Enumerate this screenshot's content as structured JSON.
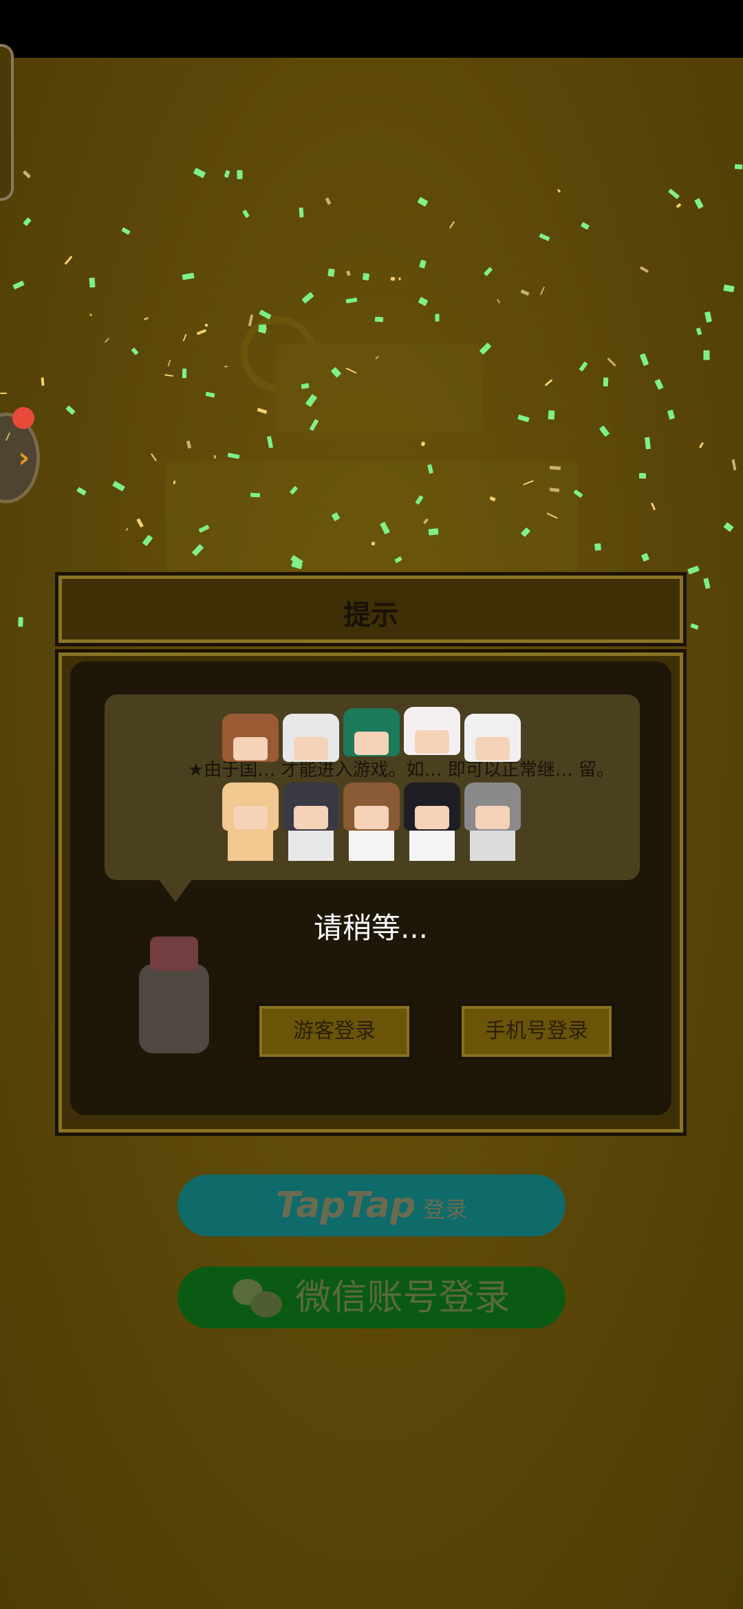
{
  "dialog": {
    "title": "提示",
    "notice_text": "★由于国… 才能进入游戏。如… 即可以正常继… 留。",
    "waiting_text": "请稍等...",
    "guest_login_label": "游客登录",
    "phone_login_label": "手机号登录"
  },
  "social_login": {
    "taptap_logo": "TapTap",
    "taptap_suffix": "登录",
    "wechat_label": "微信账号登录"
  },
  "colors": {
    "background": "#5a4608",
    "dialog_frame": "#3e2f06",
    "taptap_button": "#0f6a6a",
    "wechat_button": "#0a5a14",
    "notification_dot": "#e84a3a"
  },
  "icons": [
    "chevron-right-icon",
    "notification-dot-icon",
    "wechat-icon"
  ]
}
